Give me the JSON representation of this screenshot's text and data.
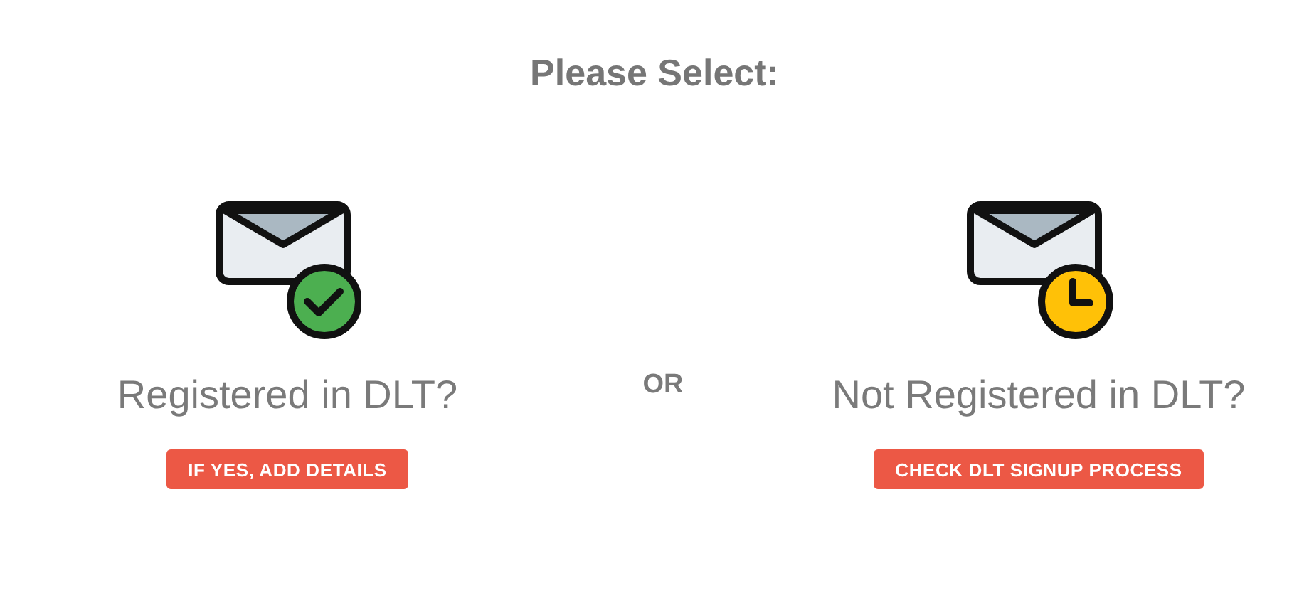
{
  "title": "Please Select:",
  "separator": "OR",
  "options": [
    {
      "kind": "check",
      "heading": "Registered in DLT?",
      "button": "IF YES, ADD DETAILS"
    },
    {
      "kind": "clock",
      "heading": "Not Registered in DLT?",
      "button": "CHECK DLT SIGNUP PROCESS"
    }
  ]
}
